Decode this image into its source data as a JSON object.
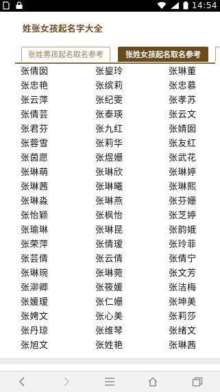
{
  "status_bar": {
    "time": "14:54",
    "icons": [
      "sim-icon",
      "lock-icon",
      "wifi-icon",
      "signal-icon",
      "battery-icon"
    ]
  },
  "header": {
    "title": "姓张女孩起名字大全"
  },
  "tabs": [
    {
      "label": "张姓男孩起名取名参考",
      "active": false
    },
    {
      "label": "张姓女孩起名取名参考",
      "active": true
    }
  ],
  "names": [
    [
      "张倩囡",
      "张鋆玲",
      "张琳董"
    ],
    [
      "张忠艳",
      "张缤莉",
      "张忠慕"
    ],
    [
      "张云萍",
      "张纪雯",
      "张孝苏"
    ],
    [
      "张倩芸",
      "张泰瑛",
      "张云文"
    ],
    [
      "张君芬",
      "张九红",
      "张婧囡"
    ],
    [
      "张蓉雪",
      "张莉华",
      "张友红"
    ],
    [
      "张茵愿",
      "张煜姗",
      "张武花"
    ],
    [
      "张琳萌",
      "张琳欣",
      "张琳婷"
    ],
    [
      "张琳茜",
      "张琳曦",
      "张琳熙"
    ],
    [
      "张琳淼",
      "张琳燕",
      "张芬姗"
    ],
    [
      "张怡颖",
      "张枫怡",
      "张芝婷"
    ],
    [
      "张瑜琳",
      "张琳昆",
      "张韵娥"
    ],
    [
      "张荣萍",
      "张倩瑷",
      "张玲菲"
    ],
    [
      "张芸倩",
      "张云倩",
      "张倩宁"
    ],
    [
      "张琳琬",
      "张琳菀",
      "张文芳"
    ],
    [
      "张泖卿",
      "张筱媛",
      "张洁梅"
    ],
    [
      "张媛瑷",
      "张仁姗",
      "张坤美"
    ],
    [
      "张娉文",
      "张心美",
      "张莉莎"
    ],
    [
      "张丹琼",
      "张维琴",
      "张绪文"
    ],
    [
      "张旭文",
      "张姓艳",
      "张琳茜"
    ]
  ],
  "nav": {
    "back": "‹",
    "forward": "›",
    "menu": "≡"
  }
}
